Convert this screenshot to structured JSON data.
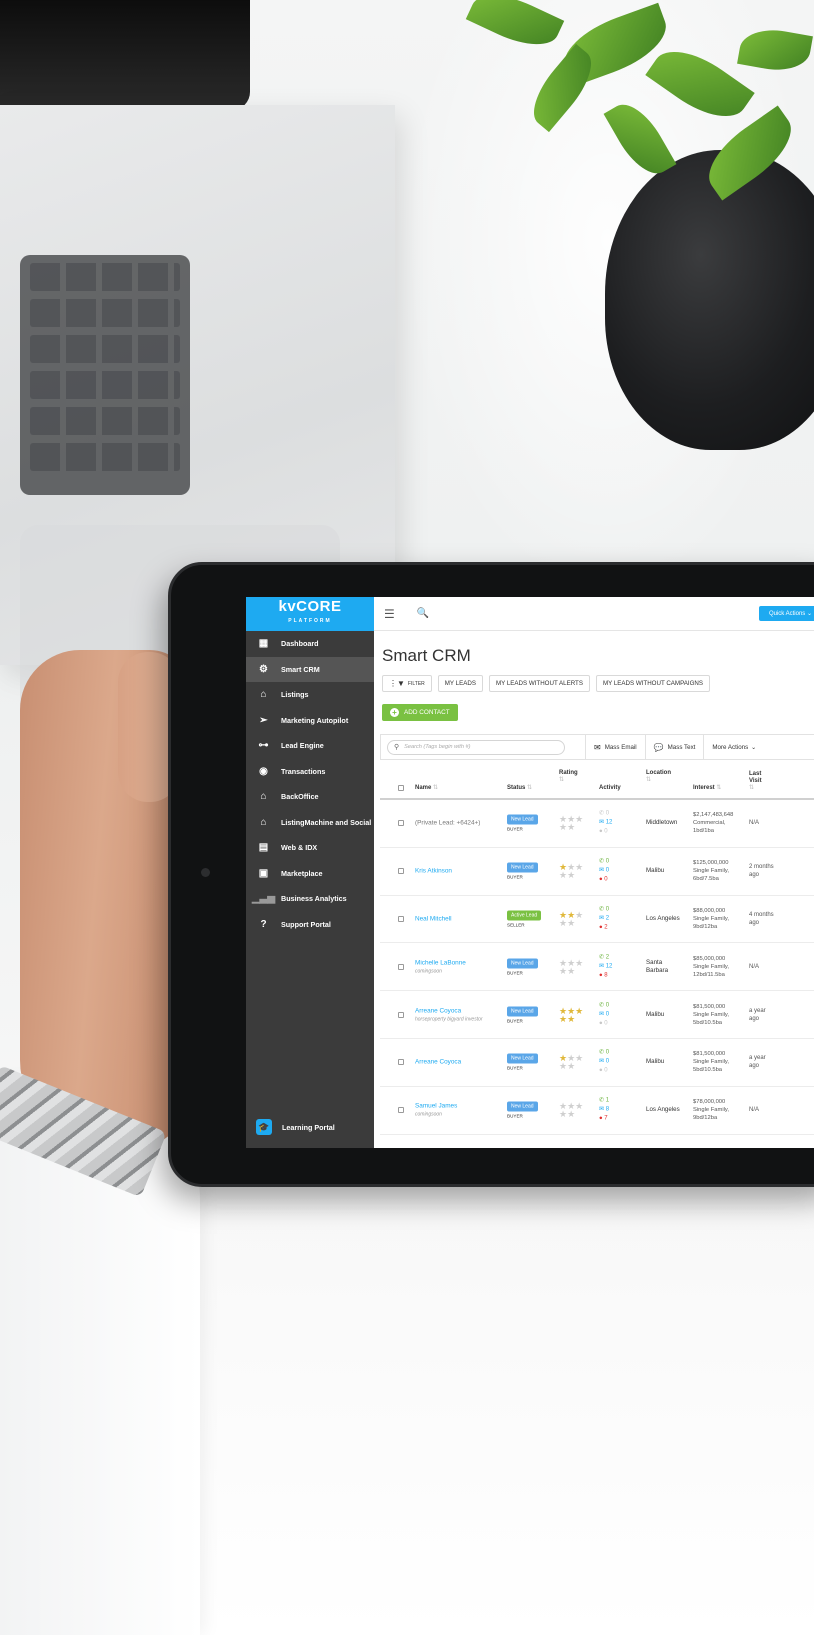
{
  "app": {
    "logo": "kvCORE",
    "logo_sub": "PLATFORM",
    "quick_actions": "Quick Actions"
  },
  "sidebar": {
    "items": [
      {
        "label": "Dashboard",
        "icon": "dashboard-icon"
      },
      {
        "label": "Smart CRM",
        "icon": "crm-icon",
        "active": true
      },
      {
        "label": "Listings",
        "icon": "home-icon"
      },
      {
        "label": "Marketing Autopilot",
        "icon": "paper-plane-icon"
      },
      {
        "label": "Lead Engine",
        "icon": "lead-engine-icon"
      },
      {
        "label": "Transactions",
        "icon": "transactions-icon"
      },
      {
        "label": "BackOffice",
        "icon": "backoffice-icon"
      },
      {
        "label": "ListingMachine and Social",
        "icon": "listing-machine-icon"
      },
      {
        "label": "Web & IDX",
        "icon": "web-icon"
      },
      {
        "label": "Marketplace",
        "icon": "marketplace-icon"
      },
      {
        "label": "Business Analytics",
        "icon": "analytics-icon"
      },
      {
        "label": "Support Portal",
        "icon": "help-icon"
      }
    ],
    "learning_portal": "Learning Portal"
  },
  "main": {
    "title": "Smart CRM",
    "filter_label": "FILTER",
    "tabs": [
      "MY LEADS",
      "MY LEADS WITHOUT ALERTS",
      "MY LEADS WITHOUT CAMPAIGNS"
    ],
    "add_contact": "ADD CONTACT",
    "search_placeholder": "Search  (Tags begin with #)",
    "mass_email": "Mass Email",
    "mass_text": "Mass Text",
    "more_actions": "More Actions"
  },
  "table": {
    "columns": {
      "name": "Name",
      "status": "Status",
      "rating": "Rating",
      "activity": "Activity",
      "location": "Location",
      "interest": "Interest",
      "last_visit_1": "Last",
      "last_visit_2": "Visit"
    },
    "rows": [
      {
        "name": "(Private Lead: +6424+)",
        "sub": "",
        "status": "New Lead",
        "type": "BUYER",
        "stars": 0,
        "calls": "0",
        "emails": "12",
        "texts": "0",
        "location": "Middletown",
        "interest": [
          "$2,147,483,648",
          "Commercial,",
          "1bd/1ba"
        ],
        "last_visit": [
          "N/A"
        ]
      },
      {
        "name": "Kris Atkinson",
        "sub": "",
        "status": "New Lead",
        "type": "BUYER",
        "stars": 1,
        "calls": "0",
        "emails": "0",
        "texts": "0",
        "location": "Malibu",
        "interest": [
          "$125,000,000",
          "Single Family,",
          "6bd/7.5ba"
        ],
        "last_visit": [
          "2 months",
          "ago"
        ]
      },
      {
        "name": "Neal Mitchell",
        "sub": "",
        "status": "Active Lead",
        "type": "SELLER",
        "stars": 2,
        "calls": "0",
        "emails": "2",
        "texts": "2",
        "location": "Los Angeles",
        "interest": [
          "$88,000,000",
          "Single Family,",
          "9bd/12ba"
        ],
        "last_visit": [
          "4 months",
          "ago"
        ]
      },
      {
        "name": "Michelle LaBonne",
        "sub": "comingsoon",
        "status": "New Lead",
        "type": "BUYER",
        "stars": 0,
        "calls": "2",
        "emails": "12",
        "texts": "8",
        "location": "Santa Barbara",
        "interest": [
          "$85,000,000",
          "Single Family,",
          "12bd/11.5ba"
        ],
        "last_visit": [
          "N/A"
        ]
      },
      {
        "name": "Arreane Coyoca",
        "sub": "horseproperty bigyard investor",
        "status": "New Lead",
        "type": "BUYER",
        "stars": 5,
        "calls": "0",
        "emails": "0",
        "texts": "0",
        "location": "Malibu",
        "interest": [
          "$81,500,000",
          "Single Family,",
          "5bd/10.5ba"
        ],
        "last_visit": [
          "a year",
          "ago"
        ]
      },
      {
        "name": "Arreane Coyoca",
        "sub": "",
        "status": "New Lead",
        "type": "BUYER",
        "stars": 1,
        "calls": "0",
        "emails": "0",
        "texts": "0",
        "location": "Malibu",
        "interest": [
          "$81,500,000",
          "Single Family,",
          "5bd/10.5ba"
        ],
        "last_visit": [
          "a year",
          "ago"
        ]
      },
      {
        "name": "Samuel James",
        "sub": "comingsoon",
        "status": "New Lead",
        "type": "BUYER",
        "stars": 0,
        "calls": "1",
        "emails": "8",
        "texts": "7",
        "location": "Los Angeles",
        "interest": [
          "$78,000,000",
          "Single Family,",
          "9bd/12ba"
        ],
        "last_visit": [
          "N/A"
        ]
      }
    ]
  },
  "colors": {
    "accent": "#1eaaf1",
    "sidebar": "#3b3b3b",
    "add_contact": "#7ac142",
    "badge_new": "#5aa6e8",
    "badge_active": "#7ac142",
    "star": "#e0b83a"
  }
}
